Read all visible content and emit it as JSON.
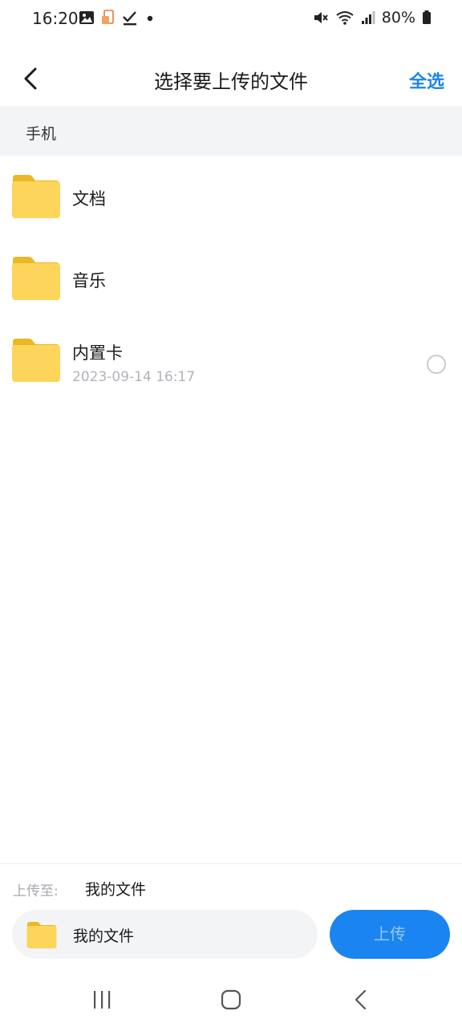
{
  "status_bar": {
    "time": "16:20",
    "battery": "80%",
    "left_icons": [
      "image-icon",
      "app-notification-icon",
      "check-icon",
      "dot-icon"
    ],
    "right_icons": [
      "mute-icon",
      "wifi-icon",
      "signal-icon",
      "battery-icon"
    ]
  },
  "header": {
    "title": "选择要上传的文件",
    "select_all": "全选"
  },
  "section": {
    "label": "手机"
  },
  "folders": [
    {
      "name": "文档",
      "date": ""
    },
    {
      "name": "音乐",
      "date": ""
    },
    {
      "name": "内置卡",
      "date": "2023-09-14 16:17"
    }
  ],
  "bottom": {
    "upload_to_label": "上传至:",
    "upload_to_value": "我的文件",
    "destination_name": "我的文件",
    "upload_button": "上传"
  },
  "colors": {
    "accent": "#1a85f0",
    "folder": "#fdd55a",
    "folder_tab": "#e9b824"
  }
}
